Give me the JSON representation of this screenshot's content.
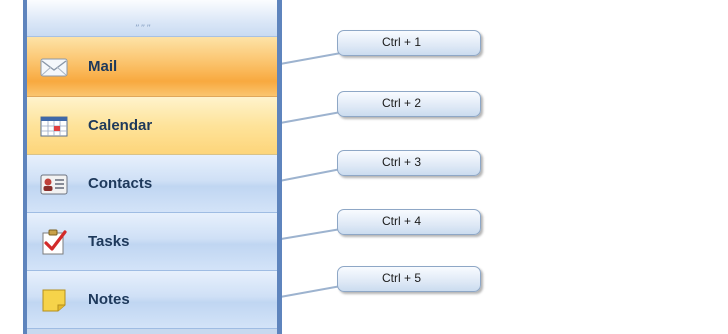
{
  "grip": {
    "text": "”””"
  },
  "nav": {
    "items": [
      {
        "label": "Mail",
        "icon": "mail-icon",
        "shortcut": "Ctrl + 1"
      },
      {
        "label": "Calendar",
        "icon": "calendar-icon",
        "shortcut": "Ctrl + 2"
      },
      {
        "label": "Contacts",
        "icon": "contacts-icon",
        "shortcut": "Ctrl + 3"
      },
      {
        "label": "Tasks",
        "icon": "tasks-icon",
        "shortcut": "Ctrl + 4"
      },
      {
        "label": "Notes",
        "icon": "notes-icon",
        "shortcut": "Ctrl + 5"
      }
    ]
  },
  "colors": {
    "selected": "#f8a93f",
    "hover": "#fee39a",
    "normal": "#cfe0f6",
    "label_text": "#1e395b",
    "border": "#5e84bd"
  }
}
